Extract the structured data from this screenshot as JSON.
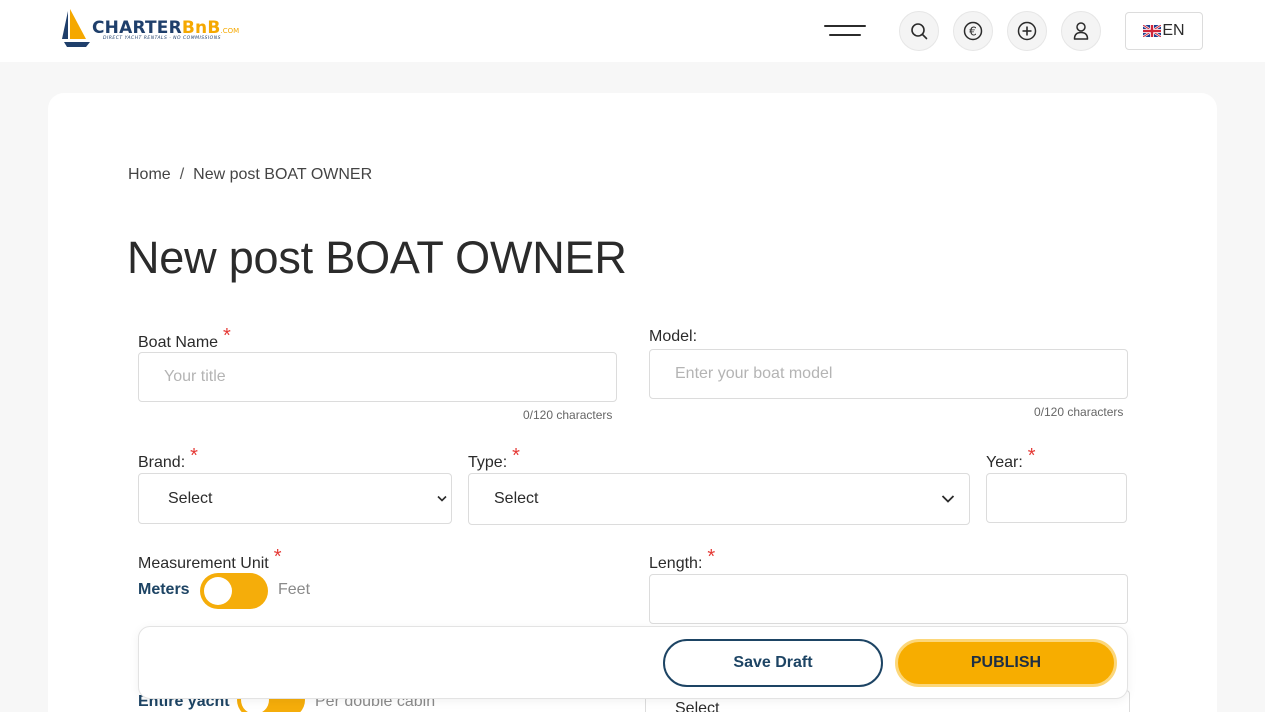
{
  "header": {
    "logo": {
      "part1": "CHARTER",
      "part2": "BnB",
      "part3": ".COM",
      "tagline": "DIRECT YACHT RENTALS · NO COMMISSIONS"
    },
    "icons": [
      "menu-icon",
      "search-icon",
      "euro-icon",
      "plus-icon",
      "user-icon"
    ],
    "language": "EN"
  },
  "breadcrumb": {
    "home": "Home",
    "separator": "/",
    "current": "New post BOAT OWNER"
  },
  "page": {
    "title": "New post BOAT OWNER"
  },
  "form": {
    "boat_name": {
      "label": "Boat Name",
      "required": "*",
      "value": "",
      "placeholder": "Your title",
      "counter": "0/120 characters"
    },
    "model": {
      "label": "Model:",
      "value": "",
      "placeholder": "Enter your boat model",
      "counter": "0/120 characters"
    },
    "brand": {
      "label": "Brand:",
      "required": "*",
      "selected": "Select"
    },
    "type": {
      "label": "Type:",
      "required": "*",
      "selected": "Select"
    },
    "year": {
      "label": "Year:",
      "required": "*",
      "value": ""
    },
    "measurement_unit": {
      "label": "Measurement Unit",
      "required": "*",
      "option_on": "Meters",
      "option_off": "Feet"
    },
    "length": {
      "label": "Length:",
      "required": "*",
      "value": ""
    },
    "charter_basis": {
      "option_on": "Entire yacht",
      "option_off": "Per double cabin"
    },
    "partial_select": {
      "selected": "Select"
    }
  },
  "actions": {
    "save_draft": "Save Draft",
    "publish": "PUBLISH"
  },
  "colors": {
    "accent": "#f7ad00",
    "navy": "#1d4464",
    "required": "#e53935"
  }
}
